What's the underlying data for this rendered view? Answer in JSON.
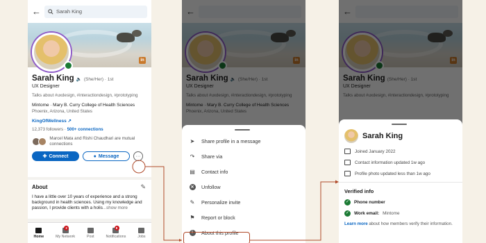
{
  "search": {
    "value": "Sarah King"
  },
  "profile": {
    "name": "Sarah King",
    "pronouns": "(She/Her) · 1st",
    "headline": "UX Designer",
    "talks_about": "Talks about #uxdesign, #interactiondesign, #prototyping",
    "education": "Mintome · Mary B. Curry College of Health Sciences",
    "location": "Phoenix, Arizona, United States",
    "website": "KingOfWellness",
    "followers": "12,373 followers · ",
    "connections": "500+ connections",
    "mutual": "Marcel Mata and Rishi Chaudhari are mutual connections",
    "connect_label": "Connect",
    "message_label": "Message",
    "more_label": "···",
    "linkedin_badge": "in"
  },
  "about": {
    "title": "About",
    "text": "I have a little over 10 years of experience and a strong background in health sciences. Using my knowledge and passion, I provide clients with a holis",
    "more": "...show more"
  },
  "nav": [
    {
      "label": "Home",
      "badge": ""
    },
    {
      "label": "My Network",
      "badge": "2"
    },
    {
      "label": "Post",
      "badge": ""
    },
    {
      "label": "Notifications",
      "badge": "8"
    },
    {
      "label": "Jobs",
      "badge": ""
    }
  ],
  "menu": {
    "items": [
      {
        "label": "Share profile in a message",
        "icon": "send-icon"
      },
      {
        "label": "Share via",
        "icon": "share-icon"
      },
      {
        "label": "Contact info",
        "icon": "contact-icon"
      },
      {
        "label": "Unfollow",
        "icon": "unfollow-icon"
      },
      {
        "label": "Personalize invite",
        "icon": "personalize-icon"
      },
      {
        "label": "Report or block",
        "icon": "flag-icon"
      },
      {
        "label": "About this profile",
        "icon": "info-icon"
      }
    ]
  },
  "about_profile": {
    "name": "Sarah King",
    "joined": "Joined January 2022",
    "contact_updated": "Contact information updated 1w ago",
    "photo_updated": "Profile photo updated less than 1w ago",
    "verified_title": "Verified info",
    "phone_label": "Phone number",
    "work_email_label": "Work email:",
    "work_email_value": "Mintome",
    "learn_more": "Learn more",
    "learn_text": " about how members verify their information."
  },
  "colors": {
    "accent": "#0a66c2",
    "connector": "#b04a2a",
    "verified": "#1b7a34",
    "background": "#f6f1e7"
  }
}
